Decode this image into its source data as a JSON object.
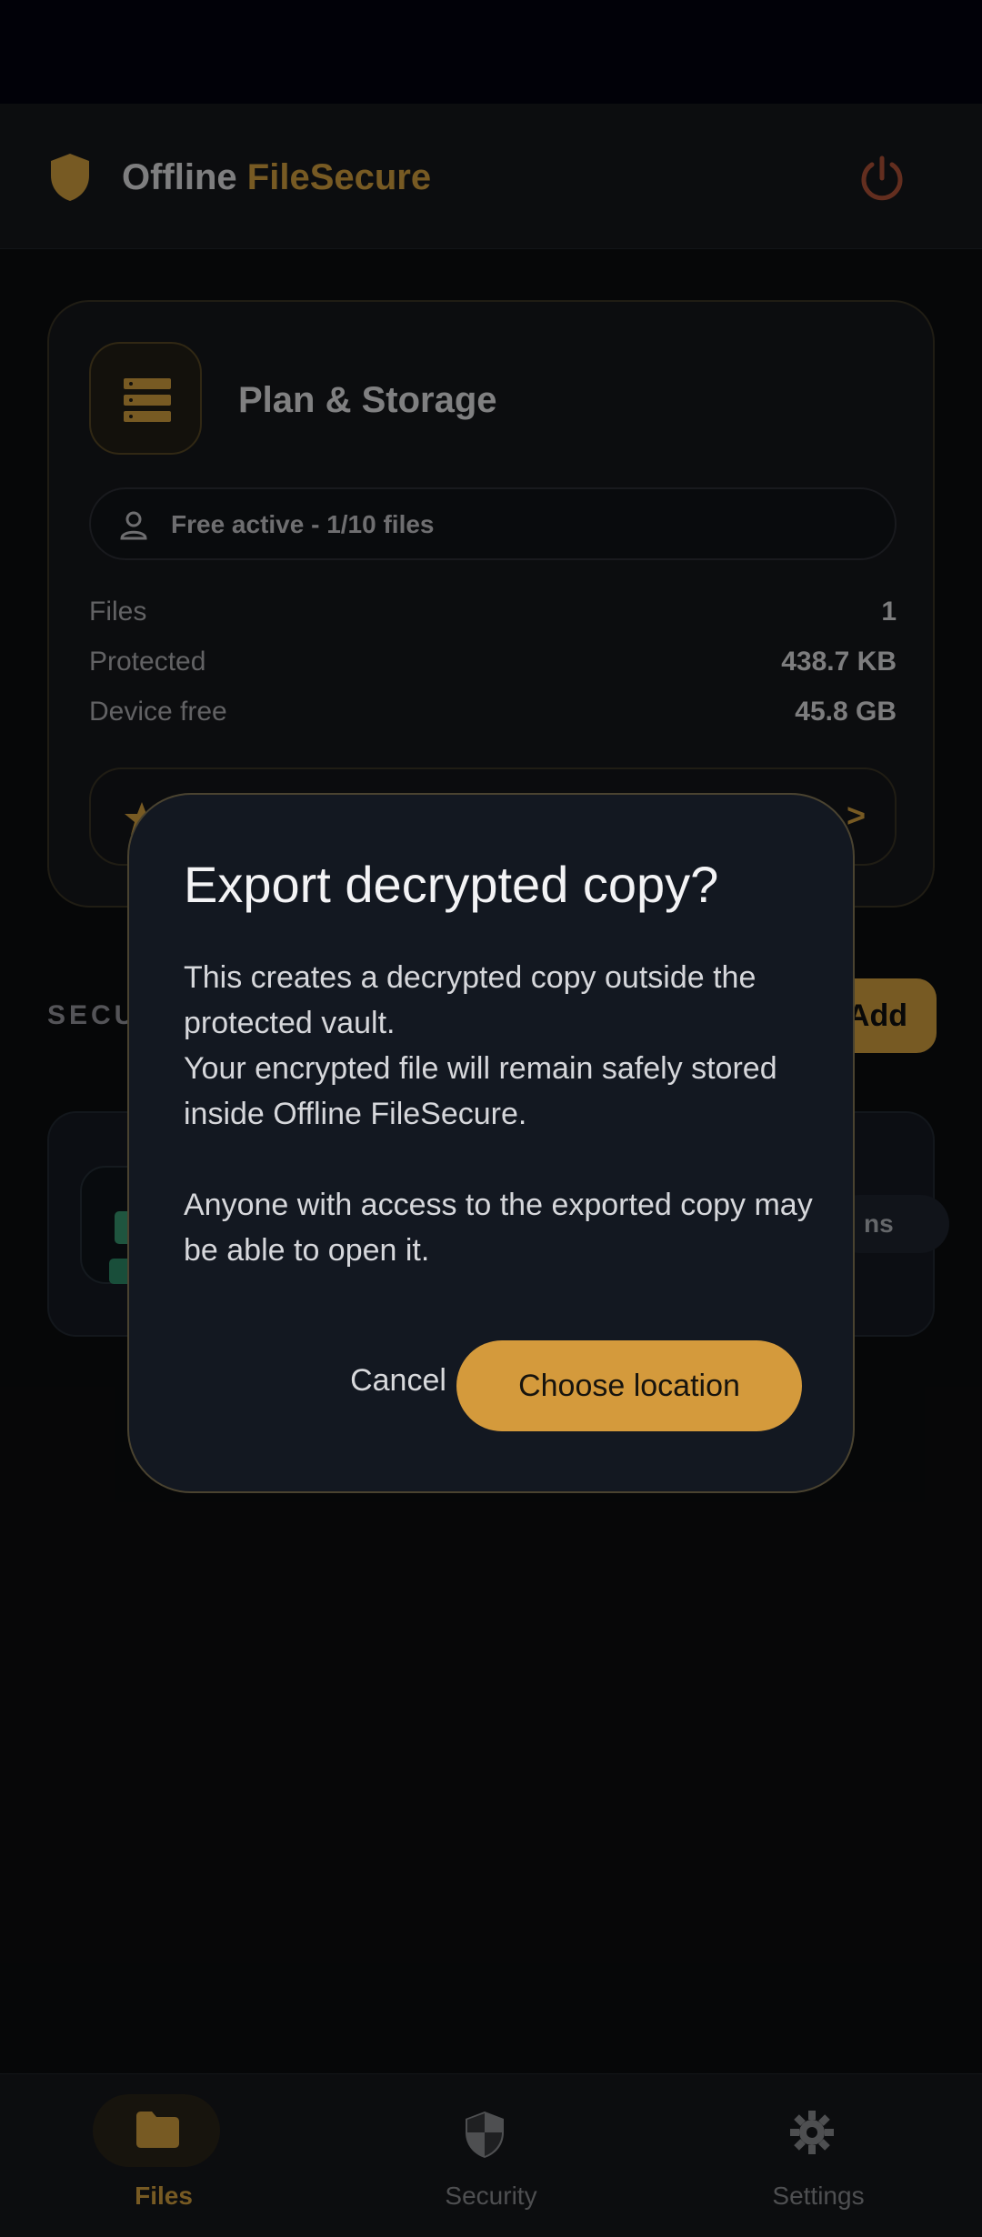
{
  "app": {
    "title_part1": "Offline",
    "title_part2": "FileSecure",
    "brand_color": "#d9a441"
  },
  "plan_card": {
    "title": "Plan & Storage",
    "status": "Free active - 1/10 files",
    "rows": [
      {
        "label": "Files",
        "value": "1"
      },
      {
        "label": "Protected",
        "value": "438.7 KB"
      },
      {
        "label": "Device free",
        "value": "45.8 GB"
      }
    ],
    "upgrade_arrow": ">"
  },
  "section": {
    "label": "SECU",
    "add_label": "Add"
  },
  "file_item": {
    "tag": "ns"
  },
  "dialog": {
    "title": "Export decrypted copy?",
    "body_line1": "This creates a decrypted copy outside the protected vault.",
    "body_line2": "Your encrypted file will remain safely stored inside Offline FileSecure.",
    "body_line3": "Anyone with access to the exported copy may be able to open it.",
    "cancel_label": "Cancel",
    "confirm_label": "Choose location"
  },
  "bottom_nav": {
    "items": [
      {
        "label": "Files",
        "icon": "folder-icon",
        "active": true
      },
      {
        "label": "Security",
        "icon": "shield-icon",
        "active": false
      },
      {
        "label": "Settings",
        "icon": "gear-icon",
        "active": false
      }
    ],
    "active_color": "#d9a441",
    "inactive_color": "#8f9094"
  }
}
